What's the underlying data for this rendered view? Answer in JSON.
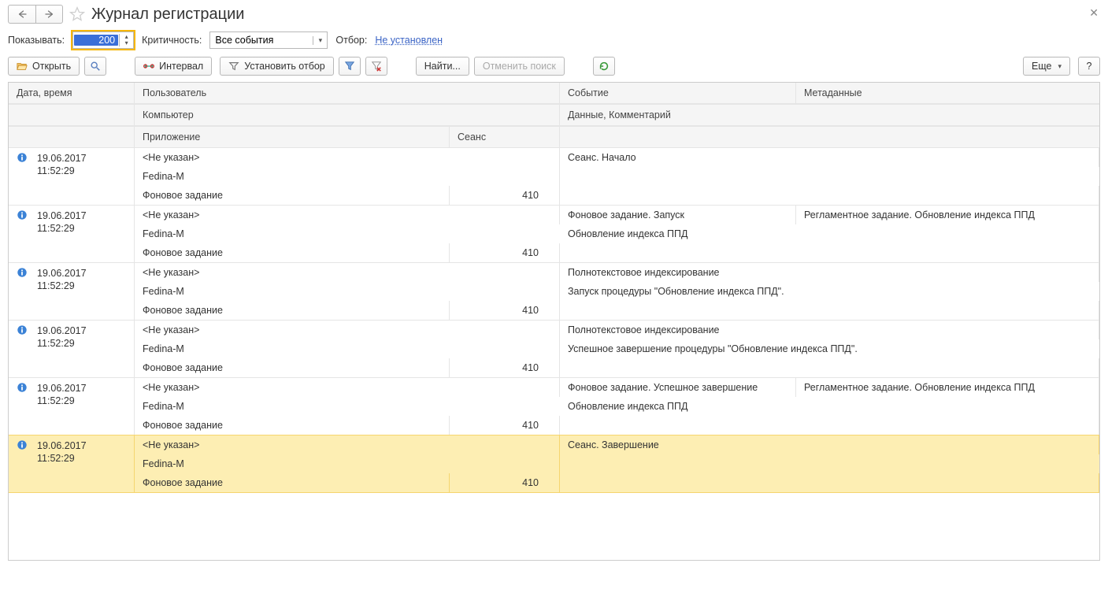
{
  "title": "Журнал регистрации",
  "filter": {
    "show_label": "Показывать:",
    "show_value": "200",
    "severity_label": "Критичность:",
    "severity_value": "Все события",
    "selection_label": "Отбор:",
    "selection_link": "Не установлен"
  },
  "toolbar": {
    "open": "Открыть",
    "interval": "Интервал",
    "set_filter": "Установить отбор",
    "find": "Найти...",
    "cancel_find": "Отменить поиск",
    "more": "Еще",
    "help": "?"
  },
  "headers": {
    "datetime": "Дата, время",
    "user": "Пользователь",
    "computer": "Компьютер",
    "application": "Приложение",
    "session": "Сеанс",
    "event": "Событие",
    "metadata": "Метаданные",
    "data_comment": "Данные, Комментарий"
  },
  "rows": [
    {
      "date": "19.06.2017",
      "time": "11:52:29",
      "user": "<Не указан>",
      "computer": "Fedina-M",
      "application": "Фоновое задание",
      "session": "410",
      "event": "Сеанс. Начало",
      "metadata": "",
      "data": "",
      "selected": false
    },
    {
      "date": "19.06.2017",
      "time": "11:52:29",
      "user": "<Не указан>",
      "computer": "Fedina-M",
      "application": "Фоновое задание",
      "session": "410",
      "event": "Фоновое задание. Запуск",
      "metadata": "Регламентное задание. Обновление индекса ППД",
      "data": "Обновление индекса ППД",
      "selected": false
    },
    {
      "date": "19.06.2017",
      "time": "11:52:29",
      "user": "<Не указан>",
      "computer": "Fedina-M",
      "application": "Фоновое задание",
      "session": "410",
      "event": "Полнотекстовое индексирование",
      "metadata": "",
      "data": "Запуск процедуры \"Обновление индекса ППД\".",
      "selected": false
    },
    {
      "date": "19.06.2017",
      "time": "11:52:29",
      "user": "<Не указан>",
      "computer": "Fedina-M",
      "application": "Фоновое задание",
      "session": "410",
      "event": "Полнотекстовое индексирование",
      "metadata": "",
      "data": "Успешное завершение процедуры \"Обновление индекса ППД\".",
      "selected": false
    },
    {
      "date": "19.06.2017",
      "time": "11:52:29",
      "user": "<Не указан>",
      "computer": "Fedina-M",
      "application": "Фоновое задание",
      "session": "410",
      "event": "Фоновое задание. Успешное завершение",
      "metadata": "Регламентное задание. Обновление индекса ППД",
      "data": "Обновление индекса ППД",
      "selected": false
    },
    {
      "date": "19.06.2017",
      "time": "11:52:29",
      "user": "<Не указан>",
      "computer": "Fedina-M",
      "application": "Фоновое задание",
      "session": "410",
      "event": "Сеанс. Завершение",
      "metadata": "",
      "data": "",
      "selected": true
    }
  ]
}
